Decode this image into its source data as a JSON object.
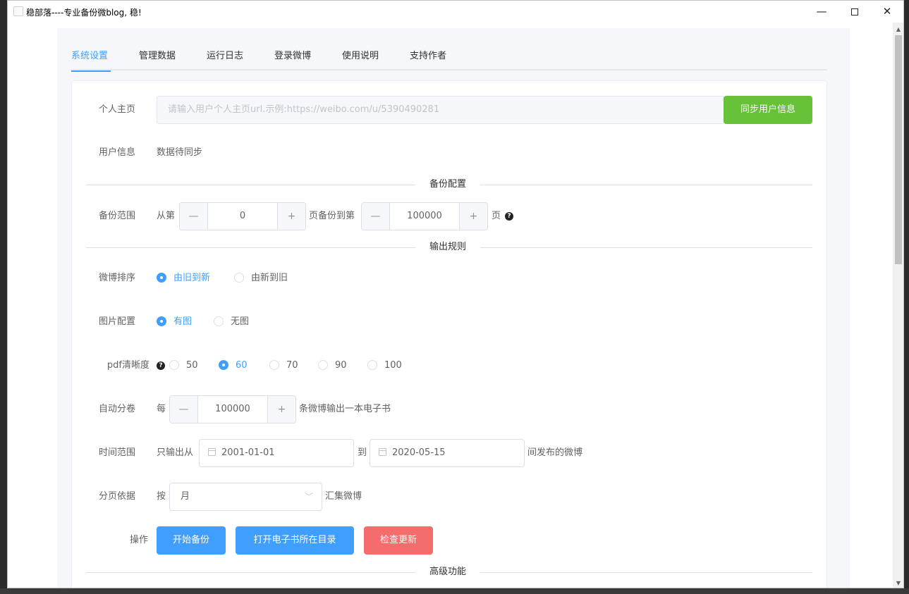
{
  "window": {
    "title": "稳部落----专业备份微blog, 稳!",
    "minimize_glyph": "—",
    "close_glyph": "✕"
  },
  "tabs": [
    {
      "label": "系统设置",
      "active": true
    },
    {
      "label": "管理数据"
    },
    {
      "label": "运行日志"
    },
    {
      "label": "登录微博"
    },
    {
      "label": "使用说明"
    },
    {
      "label": "支持作者"
    }
  ],
  "form": {
    "homepage": {
      "label": "个人主页",
      "placeholder": "请输入用户个人主页url.示例:https://weibo.com/u/5390490281",
      "sync_button": "同步用户信息"
    },
    "user_info": {
      "label": "用户信息",
      "value": "数据待同步"
    },
    "section_backup": "备份配置",
    "backup_range": {
      "label": "备份范围",
      "prefix": "从第",
      "from_value": "0",
      "middle": "页备份到第",
      "to_value": "100000",
      "suffix": "页",
      "help": "?"
    },
    "section_output": "输出规则",
    "sort": {
      "label": "微博排序",
      "options": [
        "由旧到新",
        "由新到旧"
      ],
      "selected": "由旧到新"
    },
    "image": {
      "label": "图片配置",
      "options": [
        "有图",
        "无图"
      ],
      "selected": "有图"
    },
    "pdf_quality": {
      "label": "pdf清晰度",
      "help": "?",
      "options": [
        "50",
        "60",
        "70",
        "90",
        "100"
      ],
      "selected": "60"
    },
    "auto_split": {
      "label": "自动分卷",
      "prefix": "每",
      "value": "100000",
      "suffix": "条微博输出一本电子书"
    },
    "time_range": {
      "label": "时间范围",
      "prefix": "只输出从",
      "start": "2001-01-01",
      "middle": "到",
      "end": "2020-05-15",
      "suffix": "间发布的微博"
    },
    "paging": {
      "label": "分页依据",
      "prefix": "按",
      "value": "月",
      "suffix": "汇集微博"
    },
    "actions": {
      "label": "操作",
      "start_backup": "开始备份",
      "open_dir": "打开电子书所在目录",
      "check_update": "检查更新"
    },
    "section_advanced": "高级功能",
    "stepper_minus": "—",
    "stepper_plus": "+"
  },
  "colors": {
    "accent": "#409eff",
    "success": "#67c23a",
    "danger": "#f56c6c"
  }
}
